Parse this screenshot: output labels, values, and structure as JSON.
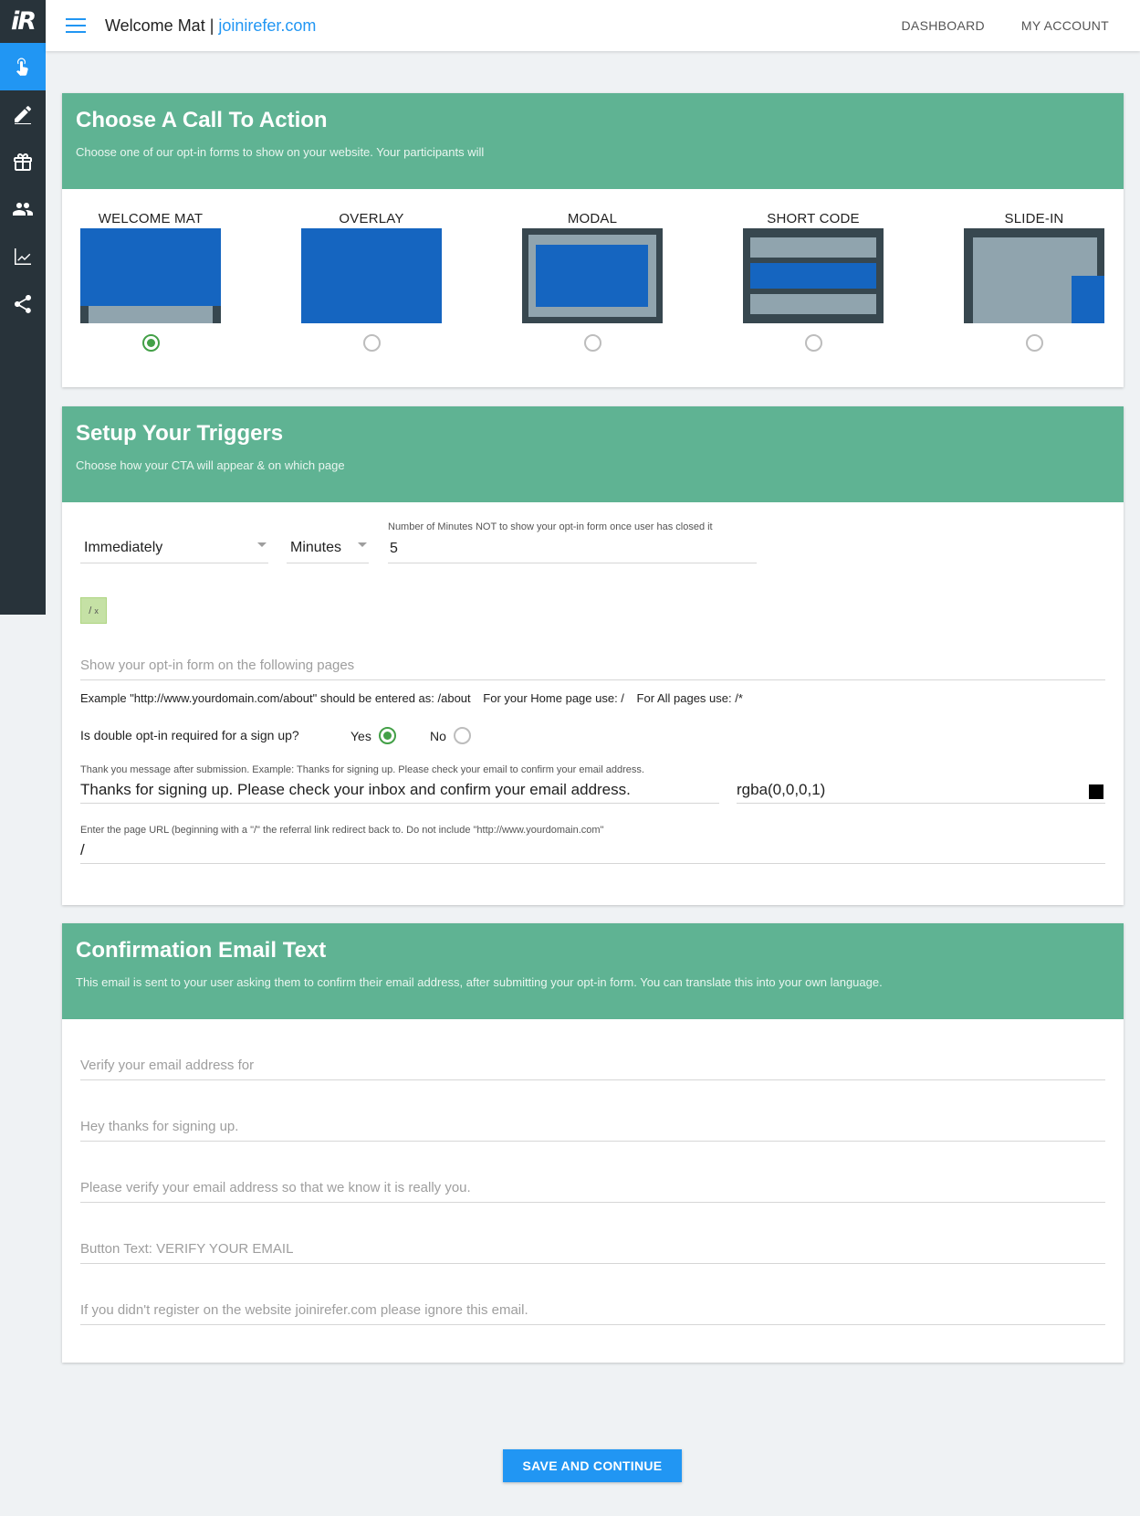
{
  "app": {
    "logo_text": "iR",
    "title": "Welcome Mat | ",
    "domain": "joinirefer.com"
  },
  "nav": {
    "dashboard": "DASHBOARD",
    "my_account": "MY ACCOUNT"
  },
  "sidebar": {
    "items": [
      {
        "icon": "pointer-hand-icon",
        "active": true
      },
      {
        "icon": "pencil-icon",
        "active": false
      },
      {
        "icon": "gift-icon",
        "active": false
      },
      {
        "icon": "people-icon",
        "active": false
      },
      {
        "icon": "chart-icon",
        "active": false
      },
      {
        "icon": "share-icon",
        "active": false
      }
    ]
  },
  "cta": {
    "title": "Choose A Call To Action",
    "subtitle": "Choose one of our opt-in forms to show on your website. Your participants will",
    "options": [
      {
        "label": "WELCOME MAT",
        "selected": true
      },
      {
        "label": "OVERLAY",
        "selected": false
      },
      {
        "label": "MODAL",
        "selected": false
      },
      {
        "label": "SHORT CODE",
        "selected": false
      },
      {
        "label": "SLIDE-IN",
        "selected": false
      }
    ]
  },
  "triggers": {
    "title": "Setup Your Triggers",
    "subtitle": "Choose how your CTA will appear & on which page",
    "trigger_select": "Immediately",
    "unit_select": "Minutes",
    "minutes_label": "Number of Minutes NOT to show your opt-in form once user has closed it",
    "minutes_value": "5",
    "tag_text": "/",
    "tag_remove": "x",
    "pages_placeholder": "Show your opt-in form on the following pages",
    "example_text": "Example \"http://www.yourdomain.com/about\" should be entered as: /about",
    "home_text": "For your Home page use: /",
    "all_text": "For All pages use: /*",
    "double_optin_question": "Is double opt-in required for a sign up?",
    "yes_label": "Yes",
    "no_label": "No",
    "double_optin_value": "Yes",
    "thanks_label": "Thank you message after submission. Example: Thanks for signing up. Please check your email to confirm your email address.",
    "thanks_value": "Thanks for signing up. Please check your inbox and confirm your email address.",
    "color_value": "rgba(0,0,0,1)",
    "redirect_label": "Enter the page URL (beginning with a \"/\" the referral link redirect back to. Do not include \"http://www.yourdomain.com\"",
    "redirect_value": "/"
  },
  "confirmation": {
    "title": "Confirmation Email Text",
    "subtitle": "This email is sent to your user asking them to confirm their email address, after submitting your opt-in form. You can translate this into your own language.",
    "fields": [
      "Verify your email address for",
      "Hey thanks for signing up.",
      "Please verify your email address so that we know it is really you.",
      "Button Text: VERIFY YOUR EMAIL",
      "If you didn't register on the website joinirefer.com please ignore this email."
    ]
  },
  "save_button": "SAVE AND CONTINUE",
  "colors": {
    "accent": "#2196f3",
    "header_green": "#5fb393",
    "sidebar": "#28333a",
    "thumb_blue": "#1565c0",
    "thumb_gray": "#90a4ae",
    "thumb_dark": "#37474f",
    "radio_green": "#43a047",
    "tag_bg": "#c5e1a5"
  }
}
